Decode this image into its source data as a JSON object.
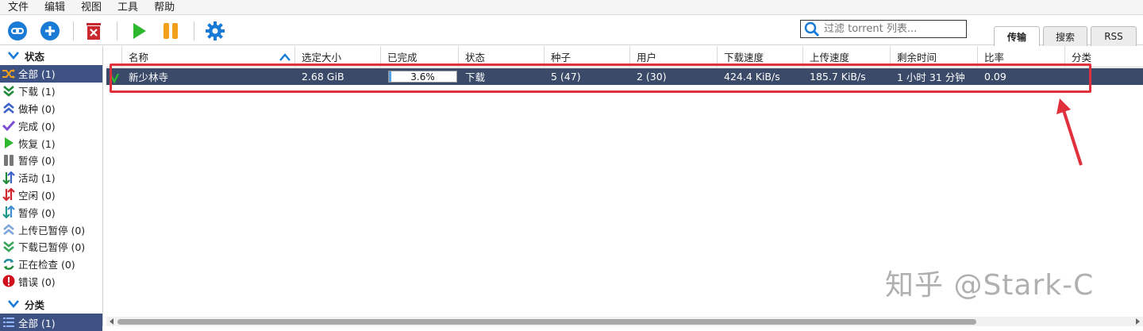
{
  "menu": [
    "文件",
    "编辑",
    "视图",
    "工具",
    "帮助"
  ],
  "toolbar": {
    "search_placeholder": "过滤 torrent 列表..."
  },
  "tabs": [
    "传输",
    "搜索",
    "RSS"
  ],
  "sidebar": {
    "status_header": "状态",
    "status_items": [
      {
        "label": "全部 (1)",
        "icon": "shuffle-icon"
      },
      {
        "label": "下载 (1)",
        "icon": "download-icon"
      },
      {
        "label": "做种 (0)",
        "icon": "upload-icon"
      },
      {
        "label": "完成 (0)",
        "icon": "checkmark-icon"
      },
      {
        "label": "恢复 (1)",
        "icon": "play-icon"
      },
      {
        "label": "暂停 (0)",
        "icon": "pause-icon"
      },
      {
        "label": "活动 (1)",
        "icon": "active-arrows-icon"
      },
      {
        "label": "空闲 (0)",
        "icon": "idle-arrows-icon"
      },
      {
        "label": "暂停 (0)",
        "icon": "stalled-arrows-icon"
      },
      {
        "label": "上传已暂停 (0)",
        "icon": "upload-paused-icon"
      },
      {
        "label": "下载已暂停 (0)",
        "icon": "download-paused-icon"
      },
      {
        "label": "正在检查 (0)",
        "icon": "refresh-icon"
      },
      {
        "label": "错误 (0)",
        "icon": "error-icon"
      }
    ],
    "category_header": "分类",
    "category_items": [
      {
        "label": "全部 (1)",
        "icon": "list-icon"
      }
    ]
  },
  "table": {
    "columns": [
      "名称",
      "选定大小",
      "已完成",
      "状态",
      "种子",
      "用户",
      "下载速度",
      "上传速度",
      "剩余时间",
      "比率",
      "分类"
    ],
    "rows": [
      {
        "name": "新少林寺",
        "size": "2.68 GiB",
        "progress_text": "3.6%",
        "progress": 0.036,
        "status": "下载",
        "seeds": "5 (47)",
        "peers": "2 (30)",
        "down_speed": "424.4 KiB/s",
        "up_speed": "185.7 KiB/s",
        "eta": "1 小时 31 分钟",
        "ratio": "0.09",
        "category": ""
      }
    ]
  },
  "watermark": "知乎 @Stark-C",
  "colors": {
    "selection": "#3d5183",
    "highlight": "#e0303c",
    "accent_blue": "#1a7bd6",
    "green": "#2eb82e",
    "orange": "#f2a01c"
  }
}
